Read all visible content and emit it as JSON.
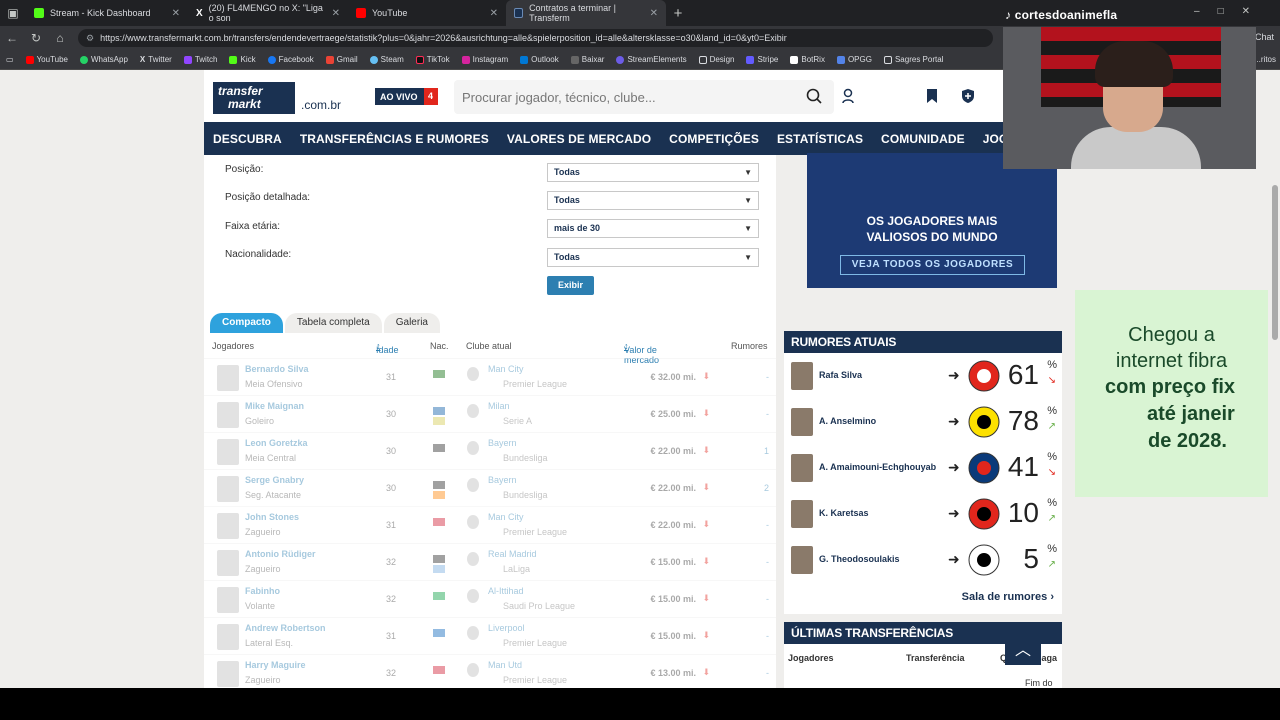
{
  "browser": {
    "tabs": [
      {
        "label": "Stream - Kick Dashboard",
        "color": "#53fc18"
      },
      {
        "label": "(20) FL4MENGO no X: \"Liga o son",
        "color": "#ffffff"
      },
      {
        "label": "YouTube",
        "color": "#ff0000"
      },
      {
        "label": "Contratos a terminar | Transferm",
        "color": "#1a3151"
      }
    ],
    "url": "https://www.transfermarkt.com.br/transfers/endendevertraege/statistik?plus=0&jahr=2026&ausrichtung=alle&spielerposition_id=alle&altersklasse=o30&land_id=0&yt0=Exibir",
    "chat_label": "Chat",
    "bookmarks": [
      "YouTube",
      "WhatsApp",
      "Twitter",
      "Twitch",
      "Kick",
      "Facebook",
      "Gmail",
      "Steam",
      "TikTok",
      "Instagram",
      "Outlook",
      "Baixar",
      "StreamElements",
      "Design",
      "Stripe",
      "BotRix",
      "OPGG",
      "Sagres Portal"
    ],
    "bookmark_more": "...ritos"
  },
  "stream": {
    "channel": "cortesdoanimefla"
  },
  "site": {
    "logo_line1": "transfer",
    "logo_line2": "markt",
    "domain": ".com.br",
    "live_label": "AO VIVO",
    "live_count": "4",
    "search_placeholder": "Procurar jogador, técnico, clube...",
    "nav": [
      "DESCUBRA",
      "TRANSFERÊNCIAS E RUMORES",
      "VALORES DE MERCADO",
      "COMPETIÇÕES",
      "ESTATÍSTICAS",
      "COMUNIDADE",
      "JOGOS"
    ]
  },
  "filters": {
    "position_label": "Posição:",
    "position_value": "Todas",
    "detailed_label": "Posição detalhada:",
    "detailed_value": "Todas",
    "age_label": "Faixa etária:",
    "age_value": "mais de 30",
    "nationality_label": "Nacionalidade:",
    "nationality_value": "Todas",
    "submit": "Exibir"
  },
  "table": {
    "tabs": [
      "Compacto",
      "Tabela completa",
      "Galeria"
    ],
    "active_tab": "Compacto",
    "headers": {
      "players": "Jogadores",
      "age": "Idade",
      "nat": "Nac.",
      "club": "Clube atual",
      "value": "Valor de mercado",
      "rumors": "Rumores"
    },
    "rows": [
      {
        "name": "Bernardo Silva",
        "pos": "Meia Ofensivo",
        "age": "31",
        "club": "Man City",
        "league": "Premier League",
        "value": "€ 32.00 mi.",
        "rumors": "-",
        "f1": "#006600",
        "f2": ""
      },
      {
        "name": "Mike Maignan",
        "pos": "Goleiro",
        "age": "30",
        "club": "Milan",
        "league": "Serie A",
        "value": "€ 25.00 mi.",
        "rumors": "-",
        "f1": "#0055a4",
        "f2": "#d4c94a"
      },
      {
        "name": "Leon Goretzka",
        "pos": "Meia Central",
        "age": "30",
        "club": "Bayern",
        "league": "Bundesliga",
        "value": "€ 22.00 mi.",
        "rumors": "1",
        "f1": "#222222",
        "f2": ""
      },
      {
        "name": "Serge Gnabry",
        "pos": "Seg. Atacante",
        "age": "30",
        "club": "Bayern",
        "league": "Bundesliga",
        "value": "€ 22.00 mi.",
        "rumors": "2",
        "f1": "#222222",
        "f2": "#ff8200"
      },
      {
        "name": "John Stones",
        "pos": "Zagueiro",
        "age": "31",
        "club": "Man City",
        "league": "Premier League",
        "value": "€ 22.00 mi.",
        "rumors": "-",
        "f1": "#cf142b",
        "f2": ""
      },
      {
        "name": "Antonio Rüdiger",
        "pos": "Zagueiro",
        "age": "32",
        "club": "Real Madrid",
        "league": "LaLiga",
        "value": "€ 15.00 mi.",
        "rumors": "-",
        "f1": "#222222",
        "f2": "#74acdf"
      },
      {
        "name": "Fabinho",
        "pos": "Volante",
        "age": "32",
        "club": "Al-Ittihad",
        "league": "Saudi Pro League",
        "value": "€ 15.00 mi.",
        "rumors": "-",
        "f1": "#009c3b",
        "f2": ""
      },
      {
        "name": "Andrew Robertson",
        "pos": "Lateral Esq.",
        "age": "31",
        "club": "Liverpool",
        "league": "Premier League",
        "value": "€ 15.00 mi.",
        "rumors": "-",
        "f1": "#005eb8",
        "f2": ""
      },
      {
        "name": "Harry Maguire",
        "pos": "Zagueiro",
        "age": "32",
        "club": "Man Utd",
        "league": "Premier League",
        "value": "€ 13.00 mi.",
        "rumors": "-",
        "f1": "#cf142b",
        "f2": ""
      }
    ]
  },
  "promo": {
    "line1": "OS JOGADORES MAIS",
    "line2": "VALIOSOS DO MUNDO",
    "button": "VEJA TODOS OS JOGADORES"
  },
  "rumors": {
    "title": "RUMORES ATUAIS",
    "items": [
      {
        "name": "Rafa Silva",
        "pct": "61",
        "trend": "down",
        "club": "benfica-crest"
      },
      {
        "name": "A. Anselmino",
        "pct": "78",
        "trend": "up",
        "club": "dortmund-crest"
      },
      {
        "name": "A. Amaimouni-Echghouyab",
        "pct": "41",
        "trend": "down",
        "club": "hamburg-crest"
      },
      {
        "name": "K. Karetsas",
        "pct": "10",
        "trend": "up",
        "club": "leverkusen-crest"
      },
      {
        "name": "G. Theodosoulakis",
        "pct": "5",
        "trend": "up",
        "club": "paok-crest"
      }
    ],
    "pct_symbol": "%",
    "more": "Sala de rumores"
  },
  "transfers": {
    "title": "ÚLTIMAS TRANSFERÊNCIAS",
    "col_players": "Jogadores",
    "col_transfer": "Transferência",
    "col_q": "Q",
    "col_paid": "paga",
    "end_text": "Fim do"
  },
  "ad": {
    "line1": "Chegou a",
    "line2": "internet fibra",
    "line3": "com preço fix",
    "line4": "até janeir",
    "line5": "de 2028."
  }
}
